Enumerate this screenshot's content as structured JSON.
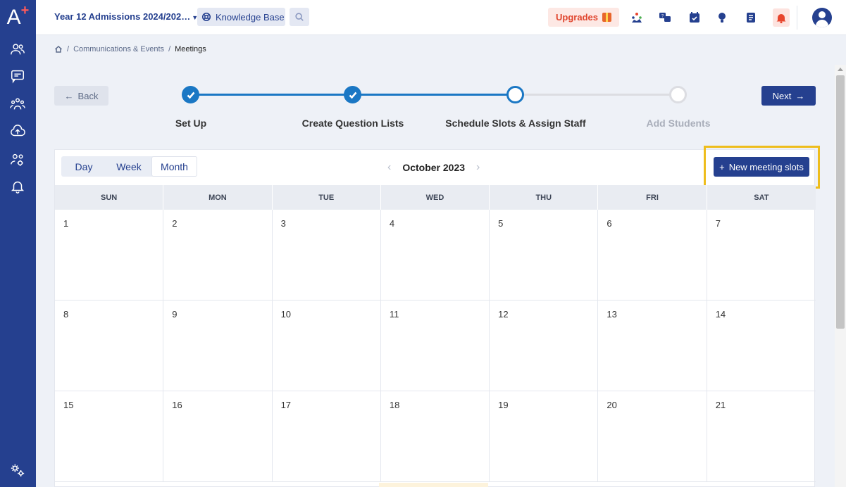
{
  "sidebar": {
    "logo": "A",
    "logo_sup": "+",
    "items": [
      {
        "icon": "people-icon"
      },
      {
        "icon": "message-icon"
      },
      {
        "icon": "groups-icon"
      },
      {
        "icon": "cloud-upload-icon"
      },
      {
        "icon": "user-settings-icon"
      },
      {
        "icon": "bell-icon"
      }
    ],
    "bottom_icon": "settings-gears-icon"
  },
  "topbar": {
    "app_title": "Year 12 Admissions 2024/202…",
    "knowledge_base": "Knowledge Base",
    "upgrades": "Upgrades",
    "icons": [
      "community-icon",
      "chat-help-icon",
      "calendar-check-icon",
      "lightbulb-icon",
      "document-icon",
      "notification-bell-icon"
    ]
  },
  "breadcrumb": {
    "items": [
      "Communications & Events"
    ],
    "separator": "/",
    "current": "Meetings"
  },
  "wizard": {
    "back": "Back",
    "next": "Next",
    "steps": [
      {
        "label": "Set Up",
        "state": "done"
      },
      {
        "label": "Create Question Lists",
        "state": "done"
      },
      {
        "label": "Schedule Slots & Assign Staff",
        "state": "active"
      },
      {
        "label": "Add Students",
        "state": "todo"
      }
    ]
  },
  "calendar": {
    "views": [
      "Day",
      "Week",
      "Month"
    ],
    "selected_view": "Month",
    "month": "October 2023",
    "new_slots_button": "New meeting slots",
    "weekdays": [
      "SUN",
      "MON",
      "TUE",
      "WED",
      "THU",
      "FRI",
      "SAT"
    ],
    "weeks": [
      [
        "1",
        "2",
        "3",
        "4",
        "5",
        "6",
        "7"
      ],
      [
        "8",
        "9",
        "10",
        "11",
        "12",
        "13",
        "14"
      ],
      [
        "15",
        "16",
        "17",
        "18",
        "19",
        "20",
        "21"
      ]
    ]
  },
  "colors": {
    "brand": "#25408f",
    "step_active": "#1a77c4",
    "highlight": "#eebd1c",
    "upgrade": "#e0452d"
  }
}
